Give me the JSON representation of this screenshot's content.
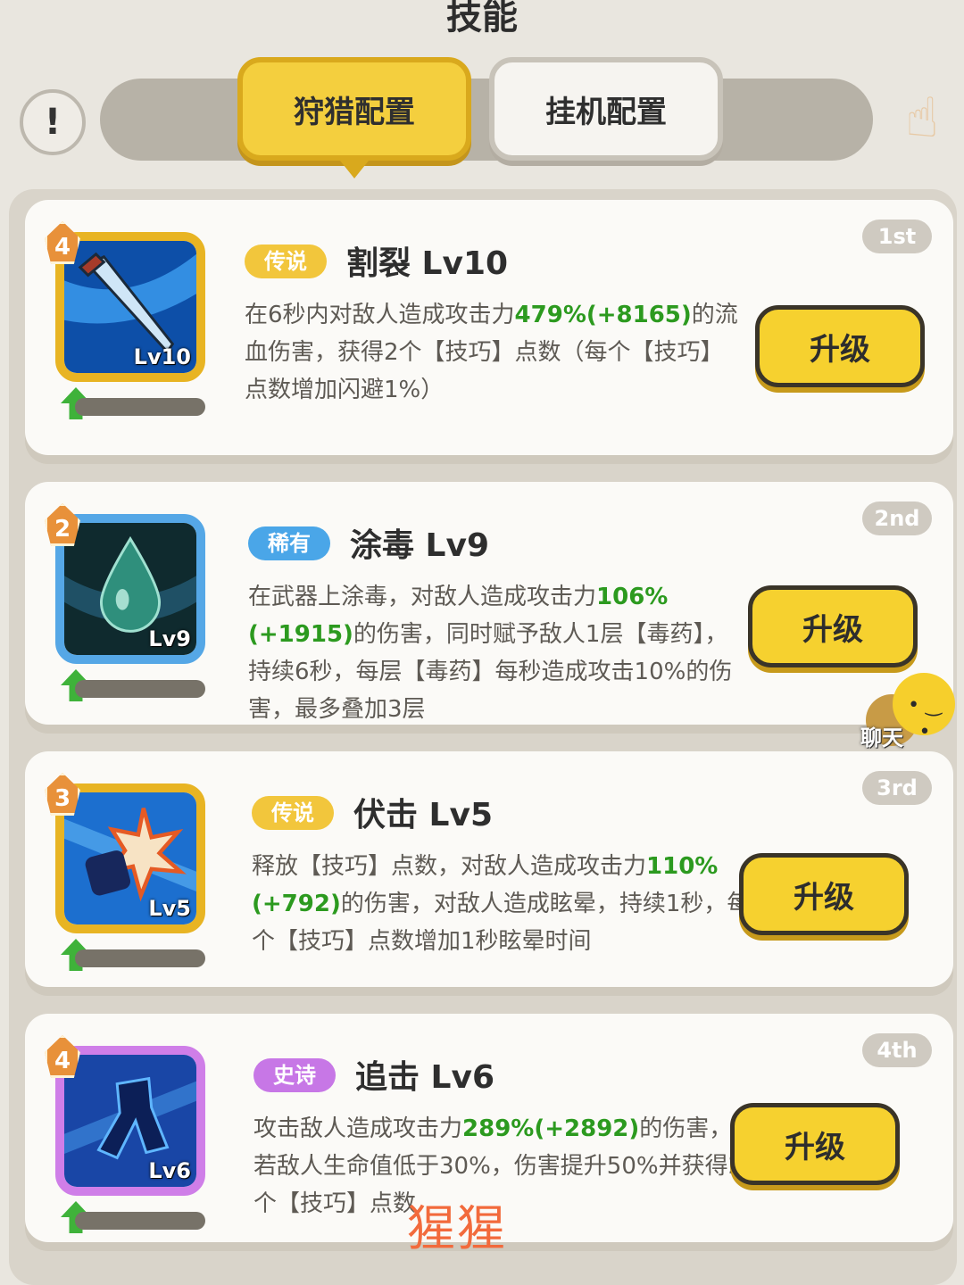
{
  "header": {
    "title": "技能"
  },
  "tabs": [
    {
      "label": "狩猎配置",
      "active": true
    },
    {
      "label": "挂机配置",
      "active": false
    }
  ],
  "icons": {
    "info": "!",
    "hand": "hand-pointer-icon"
  },
  "skills": [
    {
      "rank_gem": "4",
      "order": "1st",
      "rarity": "传说",
      "name": "割裂 Lv10",
      "icon_level": "Lv10",
      "desc_pre": "在6秒内对敌人造成攻击力",
      "desc_num": "479%(+8165)",
      "desc_post": "的流血伤害，获得2个【技巧】点数（每个【技巧】点数增加闪避1%）",
      "button": "升级"
    },
    {
      "rank_gem": "2",
      "order": "2nd",
      "rarity": "稀有",
      "name": "涂毒 Lv9",
      "icon_level": "Lv9",
      "desc_pre": "在武器上涂毒，对敌人造成攻击力",
      "desc_num": "106%(+1915)",
      "desc_post": "的伤害，同时赋予敌人1层【毒药】，持续6秒，每层【毒药】每秒造成攻击10%的伤害，最多叠加3层",
      "button": "升级"
    },
    {
      "rank_gem": "3",
      "order": "3rd",
      "rarity": "传说",
      "name": "伏击 Lv5",
      "icon_level": "Lv5",
      "desc_pre": "释放【技巧】点数，对敌人造成攻击力",
      "desc_num": "110%(+792)",
      "desc_post": "的伤害，对敌人造成眩晕，持续1秒，每个【技巧】点数增加1秒眩晕时间",
      "button": "升级"
    },
    {
      "rank_gem": "4",
      "order": "4th",
      "rarity": "史诗",
      "name": "追击 Lv6",
      "icon_level": "Lv6",
      "desc_pre": "攻击敌人造成攻击力",
      "desc_num": "289%(+2892)",
      "desc_post": "的伤害，若敌人生命值低于30%，伤害提升50%并获得2个【技巧】点数",
      "button": "升级"
    }
  ],
  "chat": {
    "label": "聊天"
  },
  "watermark": "猩猩",
  "colors": {
    "legend": "#f2c63c",
    "rare": "#4aa6e8",
    "epic": "#c777e6",
    "highlight_number": "#2c9a1f",
    "button_yellow": "#f6d12f"
  }
}
